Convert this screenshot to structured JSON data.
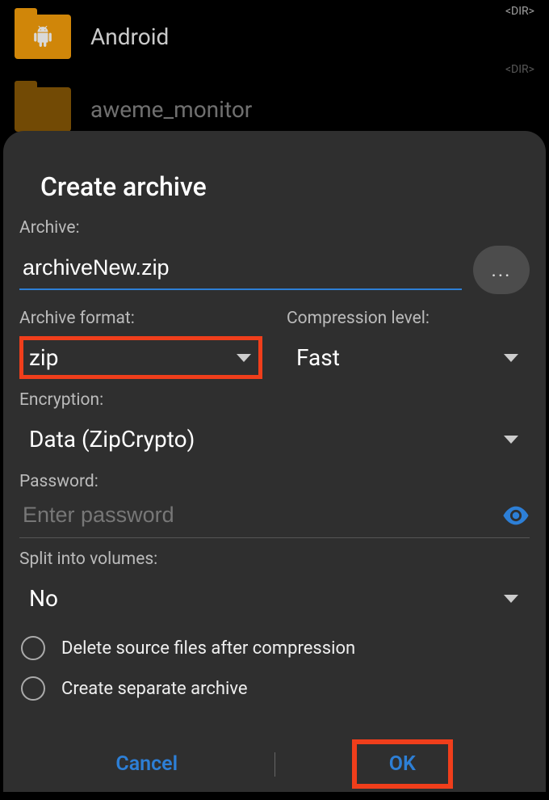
{
  "background": {
    "items": [
      {
        "label": "Android",
        "dir_tag": "<DIR>",
        "has_android_badge": true
      },
      {
        "label": "aweme_monitor",
        "dir_tag": "<DIR>",
        "has_android_badge": false
      }
    ]
  },
  "dialog": {
    "title": "Create archive",
    "archive_label": "Archive:",
    "archive_value": "archiveNew.zip",
    "browse_ellipsis": "...",
    "format_label": "Archive format:",
    "format_value": "zip",
    "compression_label": "Compression level:",
    "compression_value": "Fast",
    "encryption_label": "Encryption:",
    "encryption_value": "Data (ZipCrypto)",
    "password_label": "Password:",
    "password_placeholder": "Enter password",
    "split_label": "Split into volumes:",
    "split_value": "No",
    "radio_delete_source": "Delete source files after compression",
    "radio_separate_archive": "Create separate archive",
    "cancel_label": "Cancel",
    "ok_label": "OK"
  },
  "highlights": {
    "format_dropdown": true,
    "ok_button": true
  }
}
